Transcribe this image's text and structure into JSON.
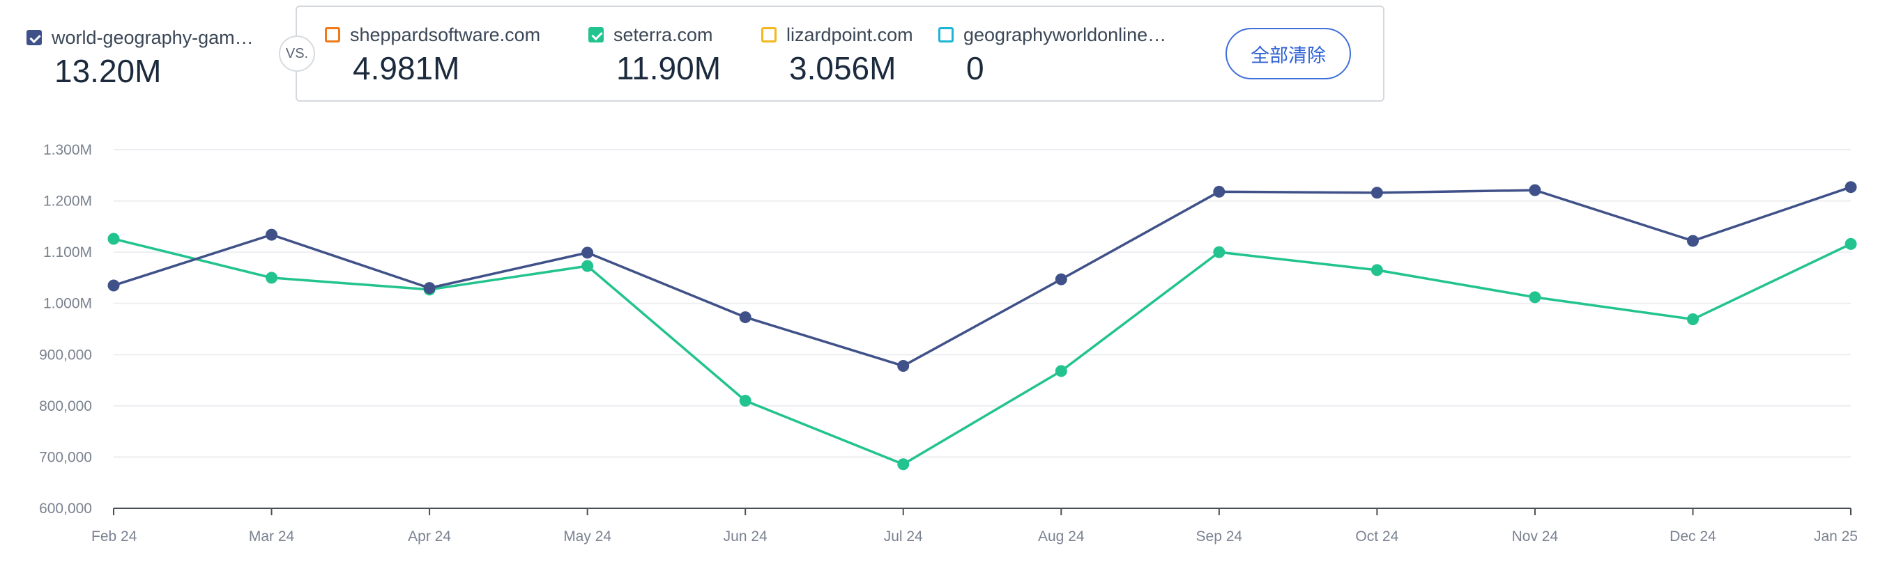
{
  "legend": {
    "primary": {
      "name": "world-geography-gam…",
      "value": "13.20M",
      "color": "#3f5188",
      "checked": true
    },
    "vs_label": "VS.",
    "competitors": [
      {
        "name": "sheppardsoftware.com",
        "value": "4.981M",
        "color": "#f07a1a",
        "checked": false
      },
      {
        "name": "seterra.com",
        "value": "11.90M",
        "color": "#22c38e",
        "checked": true
      },
      {
        "name": "lizardpoint.com",
        "value": "3.056M",
        "color": "#f2b81e",
        "checked": false
      },
      {
        "name": "geographyworldonline…",
        "value": "0",
        "color": "#1cb5d6",
        "checked": false
      }
    ],
    "clear_label": "全部清除"
  },
  "chart_data": {
    "type": "line",
    "categories": [
      "Feb 24",
      "Mar 24",
      "Apr 24",
      "May 24",
      "Jun 24",
      "Jul 24",
      "Aug 24",
      "Sep 24",
      "Oct 24",
      "Nov 24",
      "Dec 24",
      "Jan 25"
    ],
    "series": [
      {
        "name": "world-geography-gam…",
        "color": "#3f5188",
        "values": [
          1035000,
          1134000,
          1030000,
          1099000,
          973000,
          878000,
          1047000,
          1218000,
          1216000,
          1221000,
          1122000,
          1227000
        ]
      },
      {
        "name": "seterra.com",
        "color": "#22c38e",
        "values": [
          1126000,
          1050000,
          1027000,
          1073000,
          810000,
          686000,
          868000,
          1100000,
          1065000,
          1012000,
          969000,
          1116000
        ]
      }
    ],
    "yticks": [
      "600,000",
      "700,000",
      "800,000",
      "900,000",
      "1.000M",
      "1.100M",
      "1.200M",
      "1.300M"
    ],
    "ylim": [
      600000,
      1300000
    ],
    "grid": true
  }
}
